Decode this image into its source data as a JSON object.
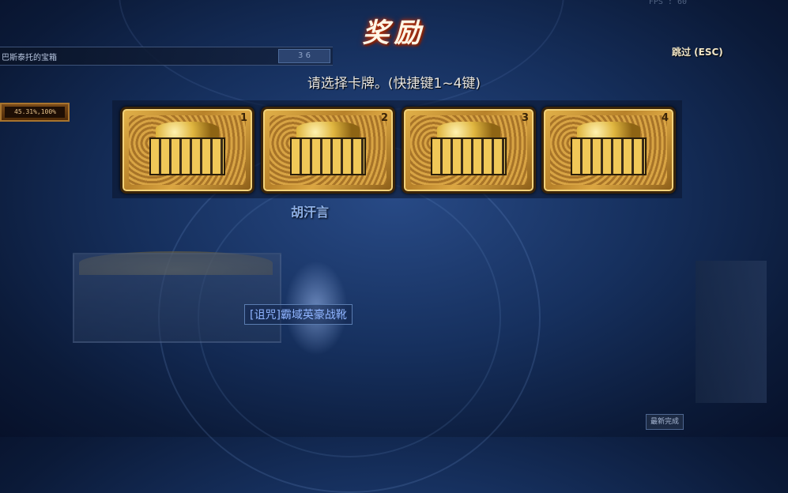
{
  "hud": {
    "fps_text": "FPS : 60",
    "dungeon_name": "巴斯泰托的宝箱",
    "dungeon_slot_text": "3 6",
    "stat_text": "45.31%,100%"
  },
  "reward": {
    "title": "奖励",
    "skip_label": "跳过 (ESC)",
    "prompt": "请选择卡牌。(快捷键1~4键)",
    "cards": [
      {
        "number": "1",
        "icon": "gold-treasure-chest-icon"
      },
      {
        "number": "2",
        "icon": "gold-treasure-chest-icon"
      },
      {
        "number": "3",
        "icon": "gold-treasure-chest-icon"
      },
      {
        "number": "4",
        "icon": "gold-treasure-chest-icon"
      }
    ]
  },
  "scene": {
    "player_name": "胡汗言",
    "dropped_item": "[诅咒]霸域英豪战靴",
    "complete_button": "最新完成"
  },
  "colors": {
    "title_glow": "#c83c14",
    "card_gold": "#e2b24a",
    "item_blue": "#8fb4ff"
  }
}
